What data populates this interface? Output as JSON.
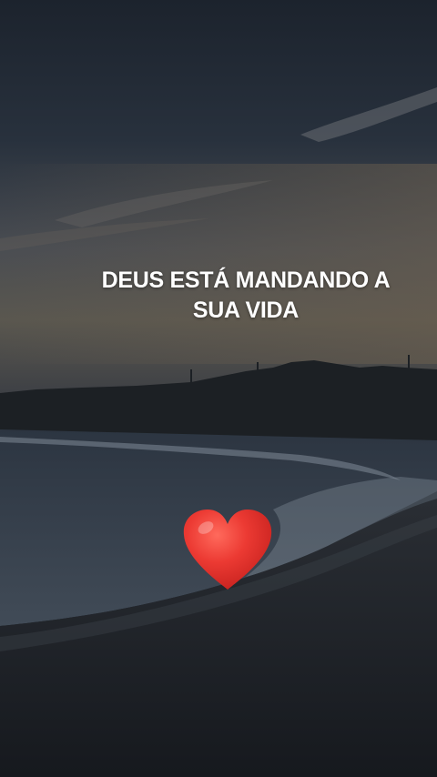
{
  "overlay_text": {
    "line1": "DEUS ESTÁ MANDANDO A",
    "line2": "SUA VIDA"
  },
  "icons": {
    "heart": "red-heart-emoji"
  },
  "colors": {
    "sky_top": "#1f2733",
    "sky_glow": "#5b5a58",
    "sea": "#3a4452",
    "foam": "#8b96a3",
    "sand": "#20242b",
    "heart": "#e8322f",
    "text": "#ffffff"
  }
}
